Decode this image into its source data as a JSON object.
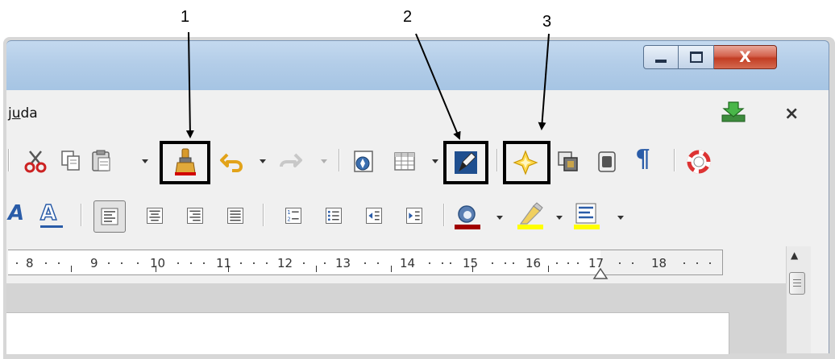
{
  "callouts": [
    {
      "number": "1"
    },
    {
      "number": "2"
    },
    {
      "number": "3"
    }
  ],
  "window": {
    "minimize_label": "–",
    "maximize_label": "□",
    "close_label": "X"
  },
  "menu": {
    "partial_item_prefix": "j",
    "partial_item_underlined": "u",
    "partial_item_suffix": "da",
    "doc_close": "×"
  },
  "toolbar_standard": {
    "icons": [
      "cut-icon",
      "copy-icon",
      "paste-icon",
      "clone-formatting-icon",
      "undo-icon",
      "redo-icon",
      "navigator-icon",
      "table-icon",
      "show-draw-functions-icon",
      "gallery-icon",
      "data-sources-icon",
      "styles-icon",
      "formatting-marks-icon",
      "help-icon"
    ],
    "formatting_marks_glyph": "¶"
  },
  "toolbar_formatting": {
    "shadow_label": "A",
    "outline_label": "A"
  },
  "ruler": {
    "labels": [
      "8",
      "9",
      "10",
      "11",
      "12",
      "13",
      "14",
      "15",
      "16",
      "17",
      "18"
    ]
  },
  "colors": {
    "highlight_box": "#000000",
    "title_bar": "#b3cde8",
    "close_button": "#c23d23",
    "font_color_bar": "#a10000",
    "highlight_yellow": "#ffff00"
  }
}
